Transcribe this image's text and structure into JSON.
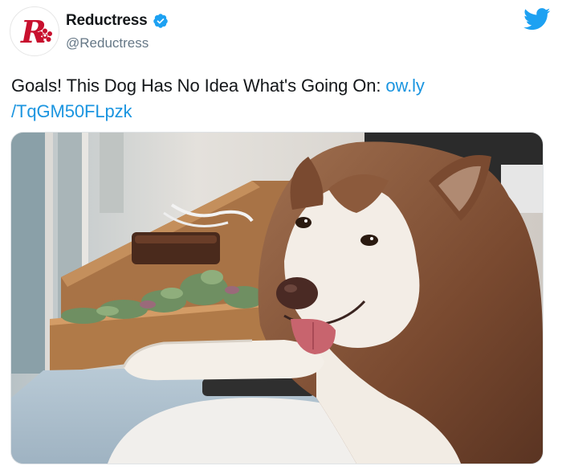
{
  "author": {
    "display_name": "Reductress",
    "handle": "@Reductress",
    "verified": true,
    "avatar_icon": "reductress-logo-icon",
    "brand_color": "#c8102e"
  },
  "platform": {
    "icon": "twitter-bird-icon",
    "color": "#1da1f2"
  },
  "tweet": {
    "text": "Goals! This Dog Has No Idea What's Going On: ",
    "link_part1": "ow.ly",
    "link_part2": "/TqGM50FLpzk",
    "link_color": "#1b95e0"
  },
  "media": {
    "type": "photo",
    "subject": "husky-dog-photo"
  }
}
